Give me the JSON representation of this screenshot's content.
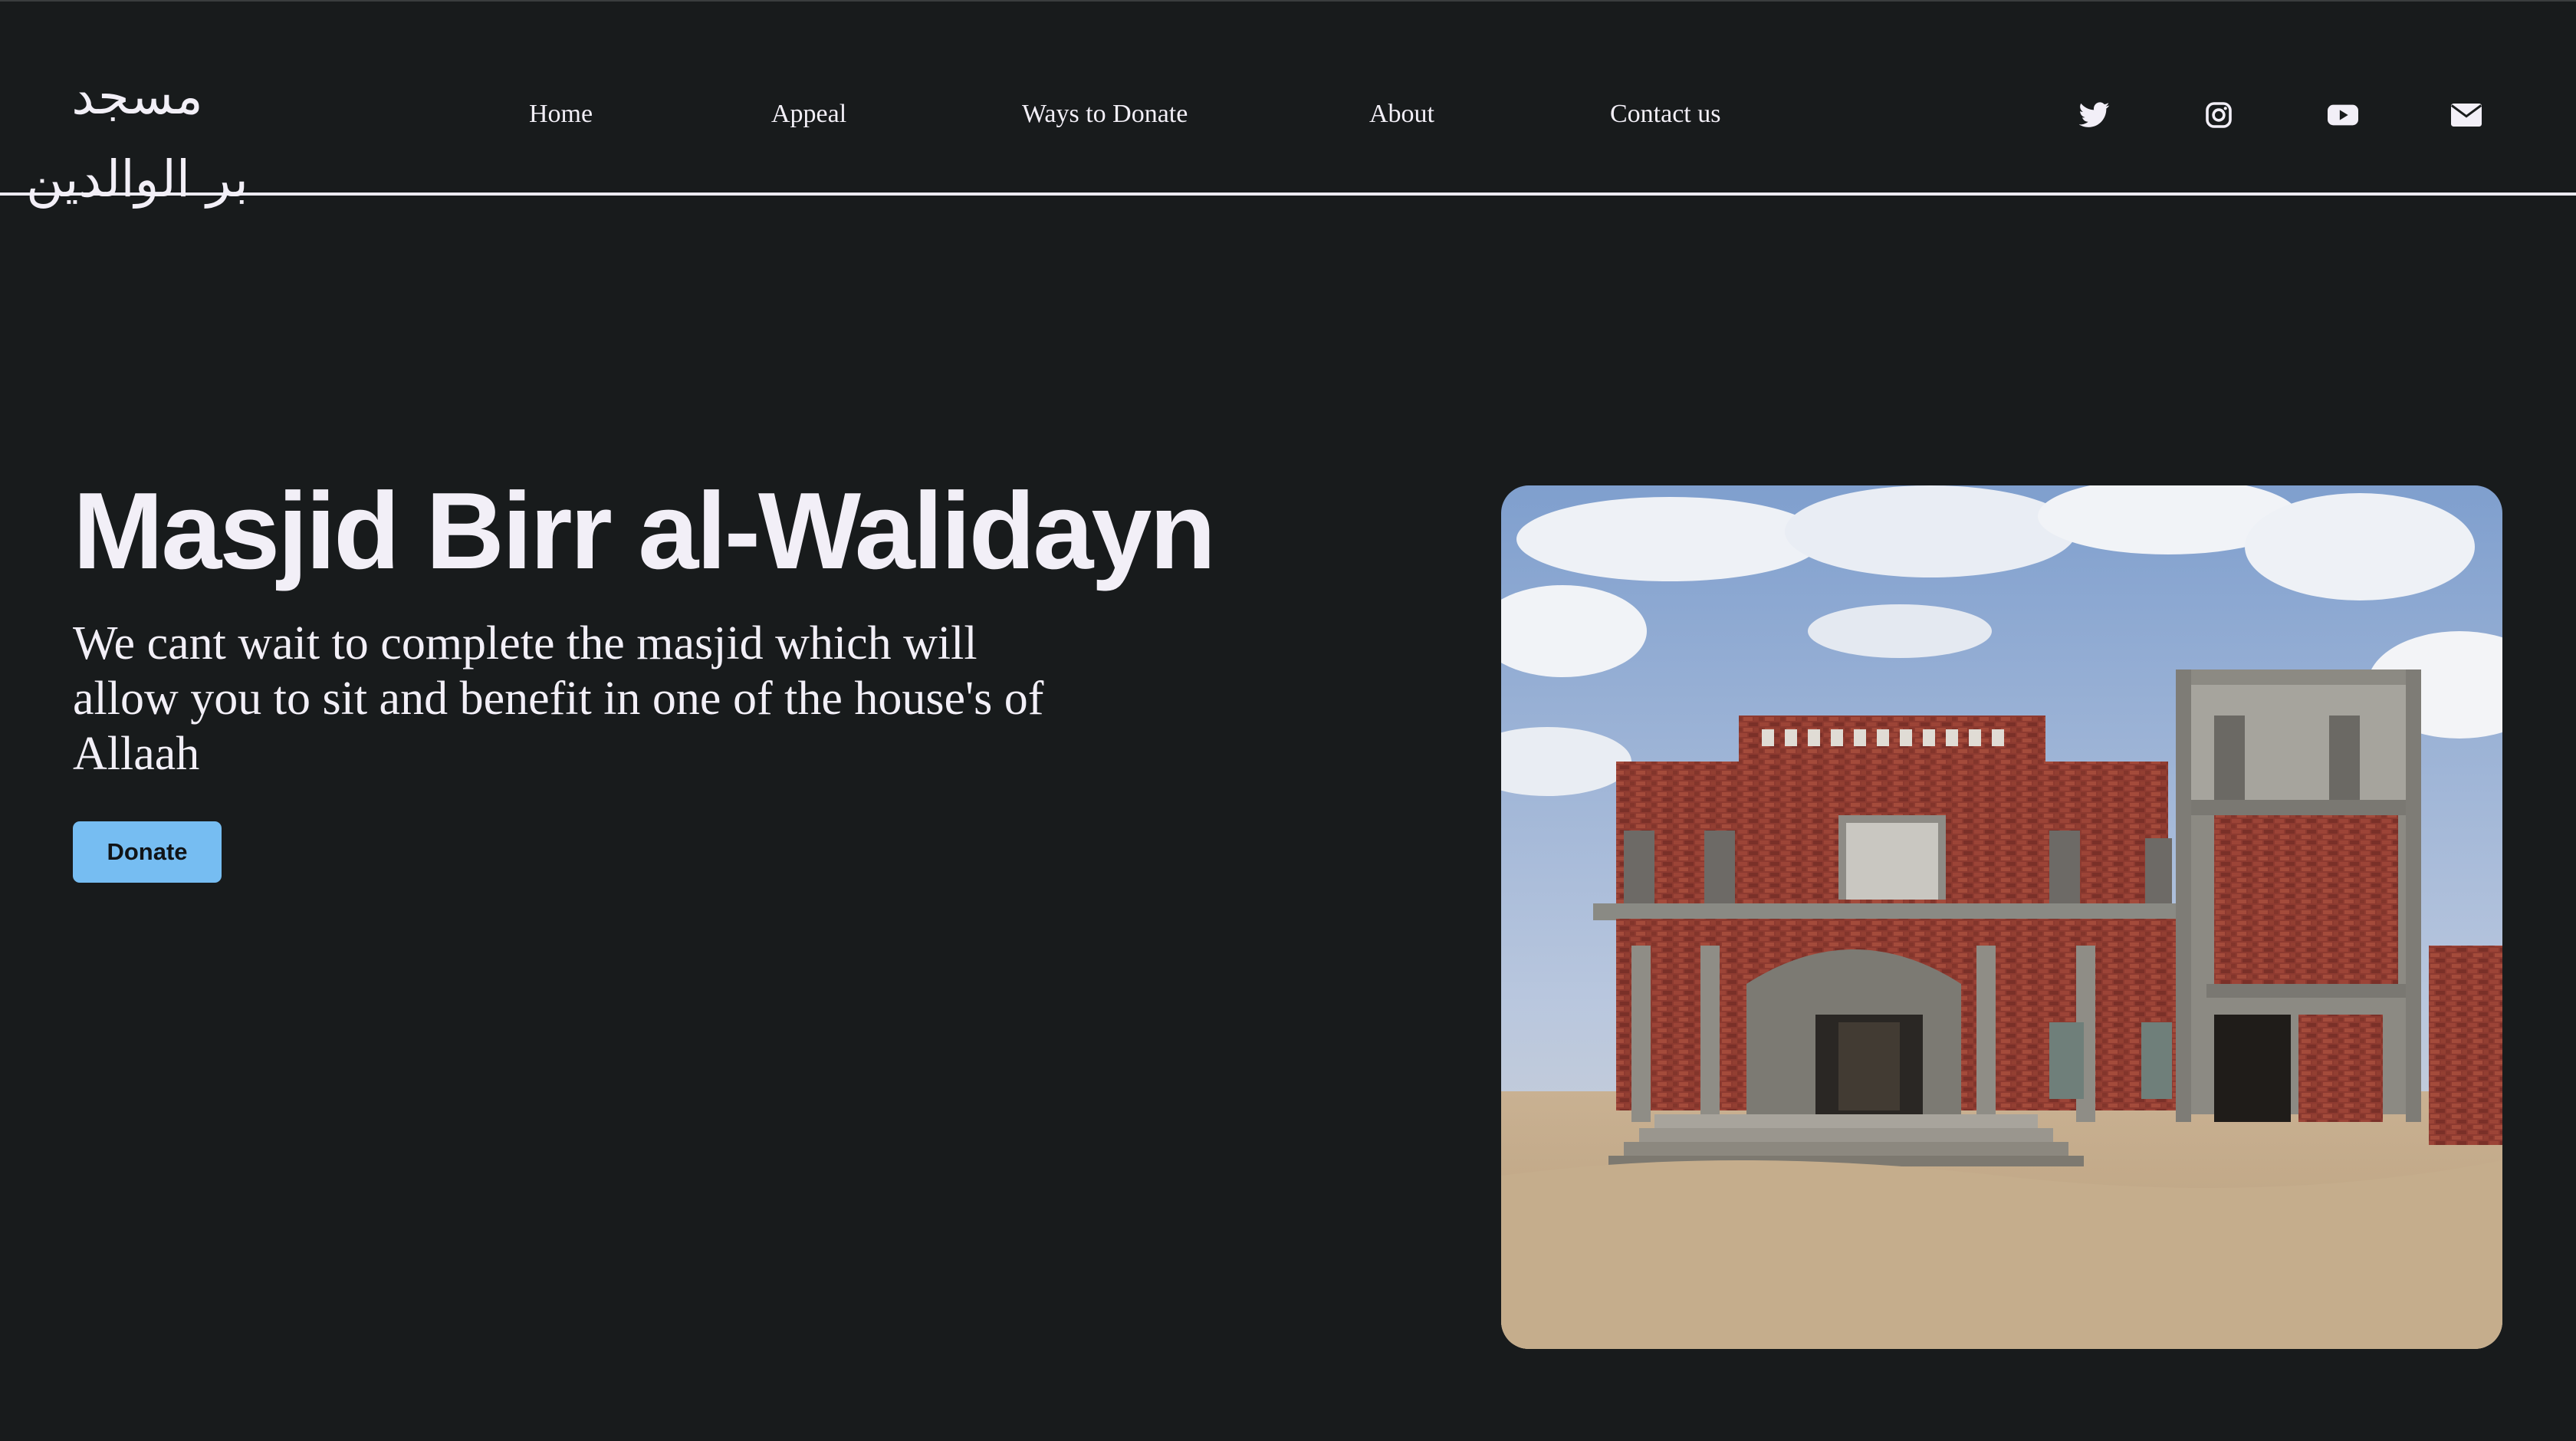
{
  "logo": {
    "line1": "مسجد",
    "line2": "بر الوالدين"
  },
  "nav": {
    "items": [
      {
        "label": "Home"
      },
      {
        "label": "Appeal"
      },
      {
        "label": "Ways to Donate"
      },
      {
        "label": "About"
      },
      {
        "label": "Contact us"
      }
    ]
  },
  "social": {
    "items": [
      {
        "icon": "twitter-icon"
      },
      {
        "icon": "instagram-icon"
      },
      {
        "icon": "youtube-icon"
      },
      {
        "icon": "mail-icon"
      }
    ]
  },
  "hero": {
    "title": "Masjid Birr al-Walidayn",
    "subtitle": "We cant wait to complete the masjid which will allow you to sit and benefit in one of the house's of Allaah",
    "donate_label": "Donate",
    "image_icon": "mosque-photo"
  },
  "colors": {
    "background": "#181b1c",
    "text": "#f2eff7",
    "accent": "#76bdf2"
  }
}
